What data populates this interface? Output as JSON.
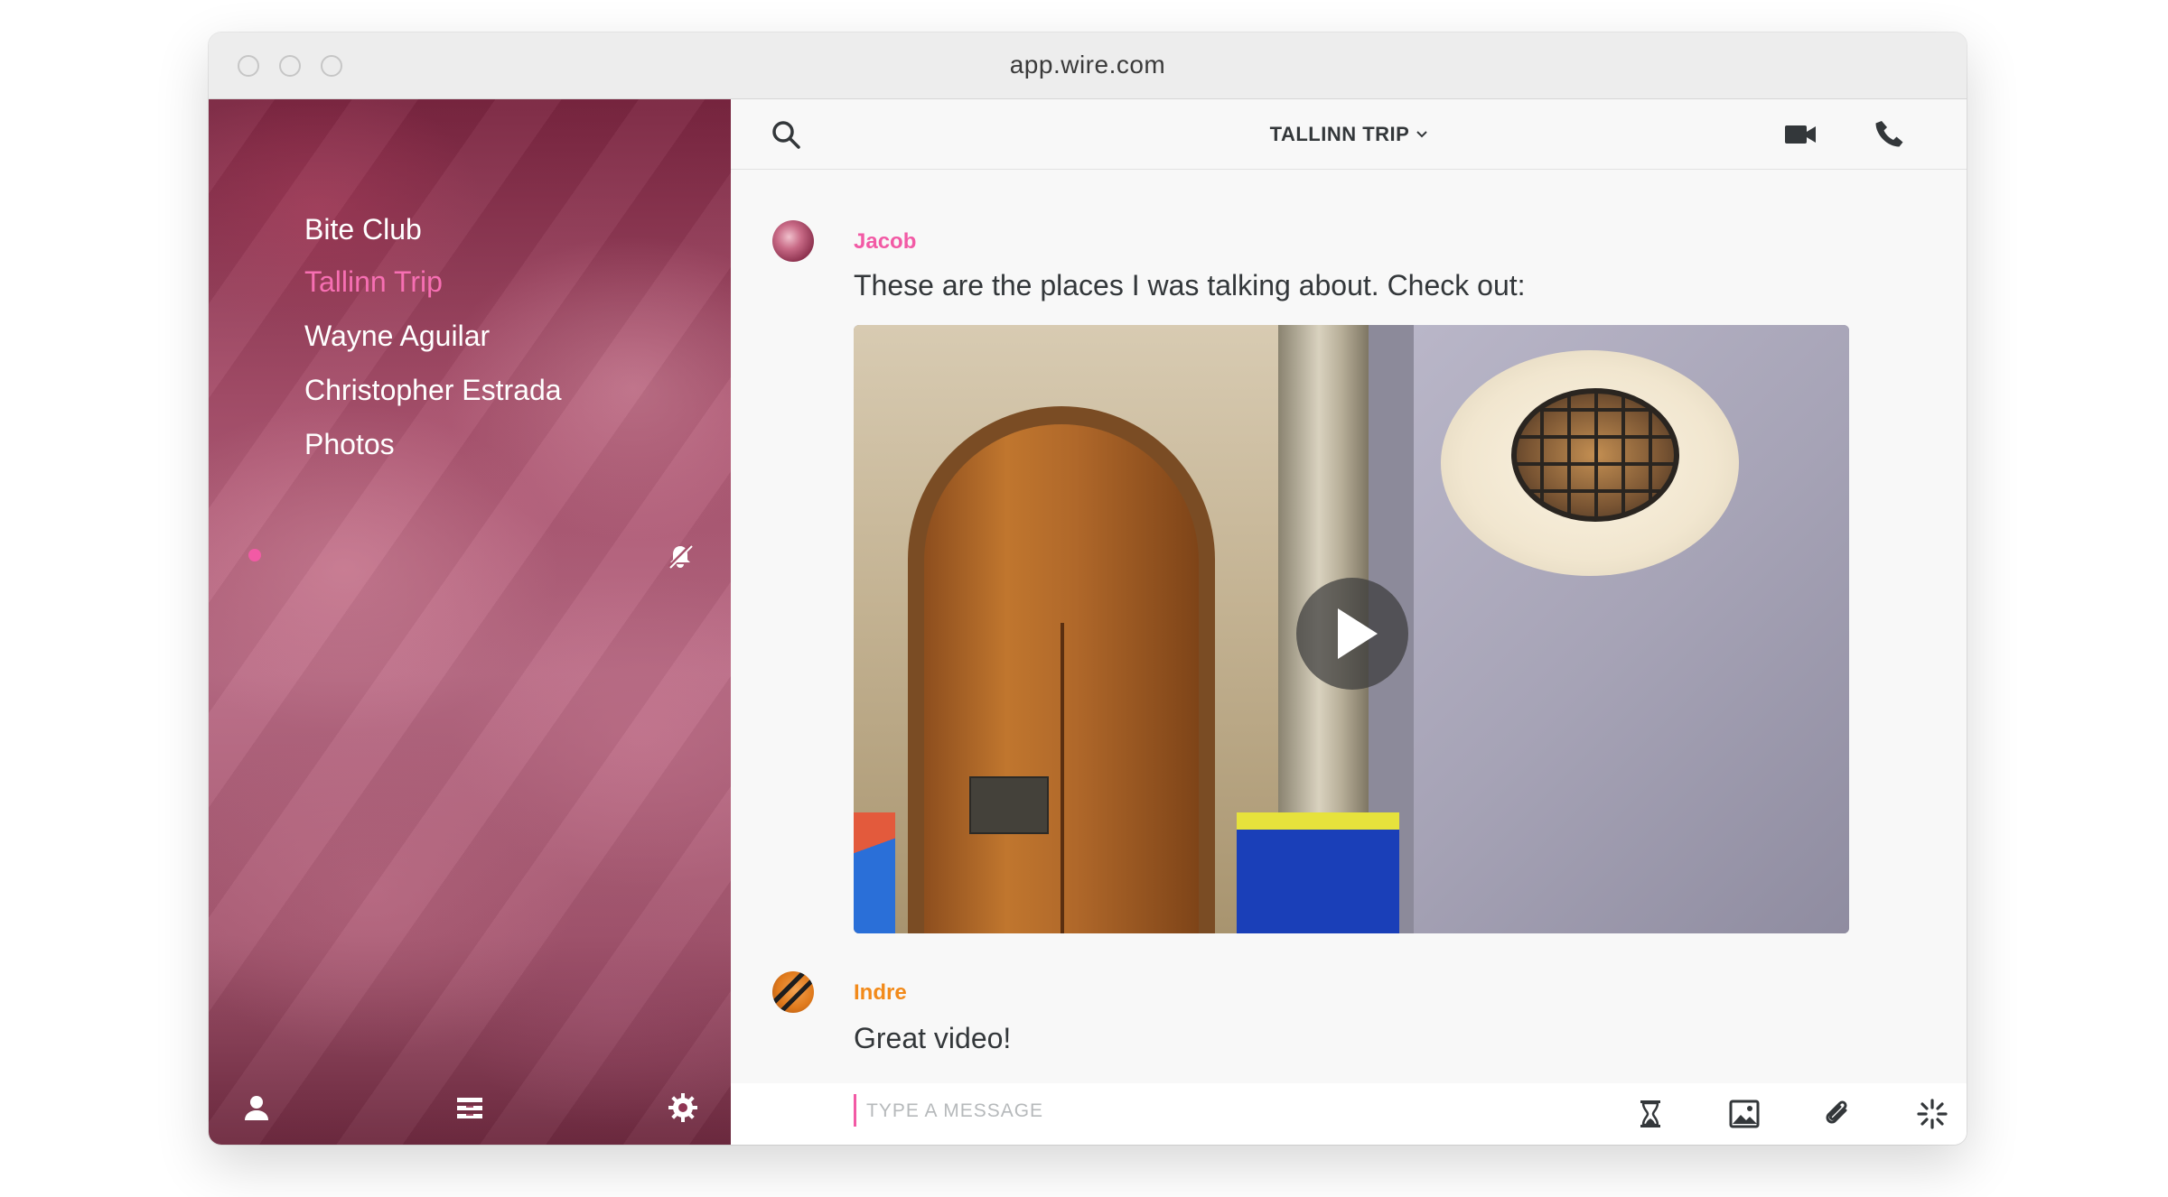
{
  "window": {
    "url": "app.wire.com"
  },
  "sidebar": {
    "conversations": [
      {
        "name": "Bite Club"
      },
      {
        "name": "Tallinn Trip"
      },
      {
        "name": "Wayne Aguilar"
      },
      {
        "name": "Christopher Estrada"
      },
      {
        "name": "Photos"
      }
    ],
    "active_color": "#f76fb3",
    "unread_dot_color": "#f25aa5",
    "footer_icons": [
      "person-icon",
      "archive-icon",
      "gear-icon"
    ]
  },
  "header": {
    "title": "TALLINN TRIP",
    "icons": [
      "search-icon",
      "video-camera-icon",
      "phone-icon"
    ]
  },
  "messages": [
    {
      "sender": "Jacob",
      "sender_color": "#f25aa5",
      "text": "These are the places I was talking about. Check out:"
    },
    {
      "sender": "Indre",
      "sender_color": "#f28a1a",
      "text": "Great video!"
    }
  ],
  "composer": {
    "placeholder": "TYPE A MESSAGE",
    "icons": [
      "hourglass-icon",
      "image-icon",
      "paperclip-icon",
      "ping-icon"
    ]
  }
}
